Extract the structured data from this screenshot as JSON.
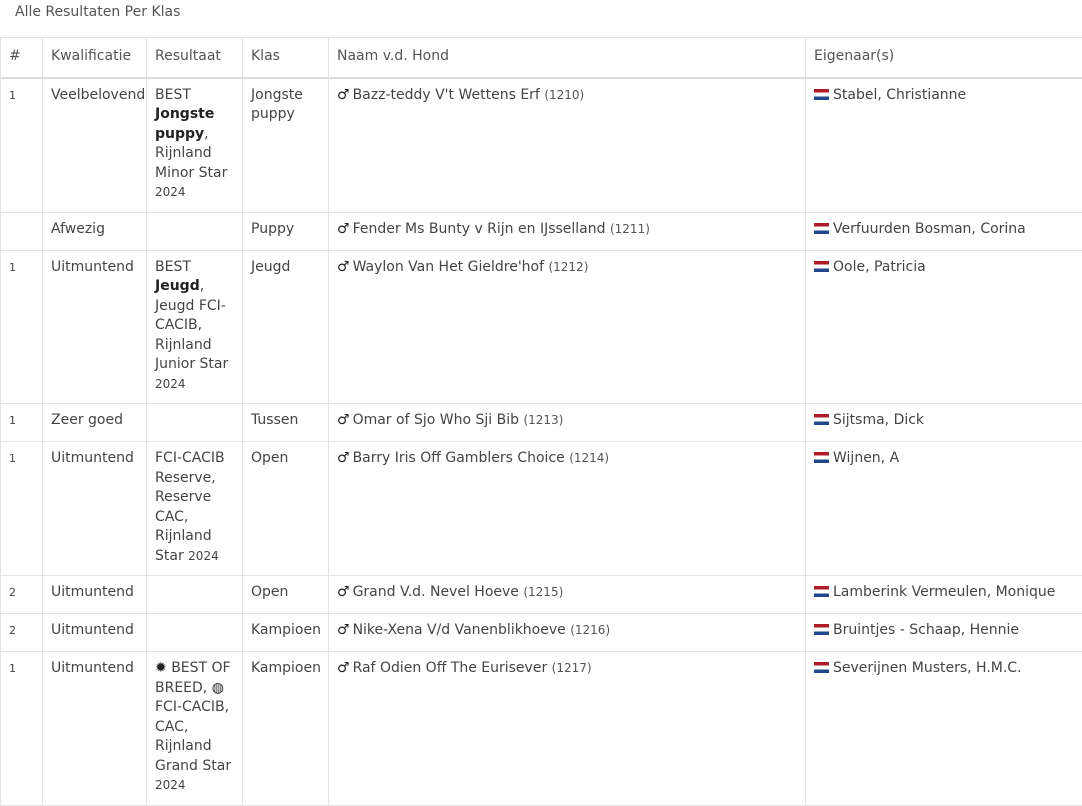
{
  "heading": "Alle Resultaten Per Klas",
  "columns": [
    "#",
    "Kwalificatie",
    "Resultaat",
    "Klas",
    "Naam v.d. Hond",
    "Eigenaar(s)"
  ],
  "rows": [
    {
      "num": "1",
      "kwal": "Veelbelovend",
      "res": {
        "pre": "BEST",
        "bold": "Jongste puppy",
        "post": ", Rijnland Minor Star",
        "year": "2024"
      },
      "klas": "Jongste puppy",
      "dog": "Bazz-teddy V't Wettens Erf",
      "dogno": "(1210)",
      "owner": "Stabel, Christianne"
    },
    {
      "num": "",
      "kwal": "Afwezig",
      "res": {
        "pre": "",
        "bold": "",
        "post": "",
        "year": ""
      },
      "klas": "Puppy",
      "dog": "Fender Ms Bunty v Rijn en IJsselland",
      "dogno": "(1211)",
      "owner": "Verfuurden Bosman, Corina"
    },
    {
      "num": "1",
      "kwal": "Uitmuntend",
      "res": {
        "pre": "BEST",
        "bold": "Jeugd",
        "post": ", Jeugd FCI-CACIB, Rijnland Junior Star",
        "year": "2024"
      },
      "klas": "Jeugd",
      "dog": "Waylon Van Het Gieldre'hof",
      "dogno": "(1212)",
      "owner": "Oole, Patricia"
    },
    {
      "num": "1",
      "kwal": "Zeer goed",
      "res": {
        "pre": "",
        "bold": "",
        "post": "",
        "year": ""
      },
      "klas": "Tussen",
      "dog": "Omar of Sjo Who Sji Bib",
      "dogno": "(1213)",
      "owner": "Sijtsma, Dick"
    },
    {
      "num": "1",
      "kwal": "Uitmuntend",
      "res": {
        "pre": "FCI-CACIB Reserve, Reserve CAC, Rijnland Star",
        "bold": "",
        "post": "",
        "year": "2024"
      },
      "klas": "Open",
      "dog": "Barry Iris Off Gamblers Choice",
      "dogno": "(1214)",
      "owner": "Wijnen, A"
    },
    {
      "num": "2",
      "kwal": "Uitmuntend",
      "res": {
        "pre": "",
        "bold": "",
        "post": "",
        "year": ""
      },
      "klas": "Open",
      "dog": "Grand V.d. Nevel Hoeve",
      "dogno": "(1215)",
      "owner": "Lamberink Vermeulen, Monique"
    },
    {
      "num": "2",
      "kwal": "Uitmuntend",
      "res": {
        "pre": "",
        "bold": "",
        "post": "",
        "year": ""
      },
      "klas": "Kampioen",
      "dog": "Nike-Xena V/d Vanenblikhoeve",
      "dogno": "(1216)",
      "owner": "Bruintjes - Schaap, Hennie"
    },
    {
      "num": "1",
      "kwal": "Uitmuntend",
      "res": {
        "pre": "BEST OF BREED,",
        "bold": "",
        "post": "FCI-CACIB, CAC, Rijnland Grand Star",
        "year": "2024"
      },
      "klas": "Kampioen",
      "dog": "Raf Odien Off The Eurisever",
      "dogno": "(1217)",
      "owner": "Severijnen Musters, H.M.C."
    }
  ],
  "icons": {
    "male": "male-symbol-icon",
    "flag": "netherlands-flag-icon",
    "badge": "starburst-icon",
    "globe": "globe-icon"
  }
}
